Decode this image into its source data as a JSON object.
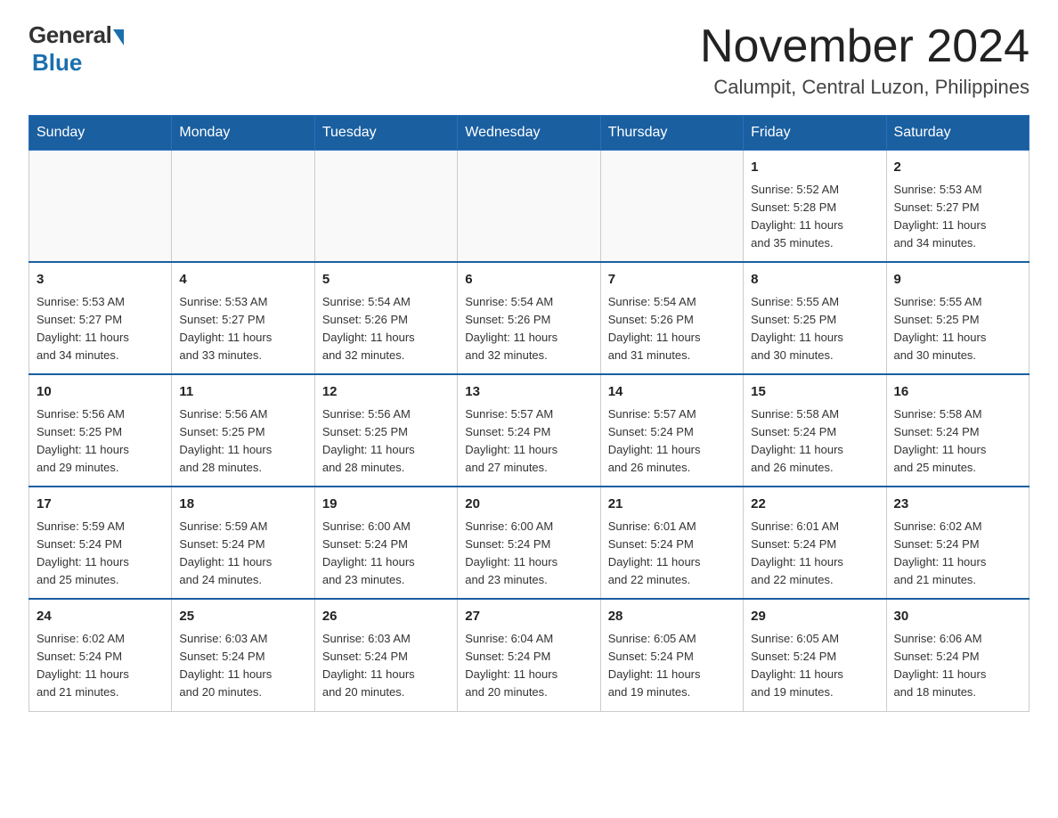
{
  "logo": {
    "general": "General",
    "blue": "Blue"
  },
  "title": "November 2024",
  "subtitle": "Calumpit, Central Luzon, Philippines",
  "weekdays": [
    "Sunday",
    "Monday",
    "Tuesday",
    "Wednesday",
    "Thursday",
    "Friday",
    "Saturday"
  ],
  "weeks": [
    [
      {
        "day": "",
        "info": ""
      },
      {
        "day": "",
        "info": ""
      },
      {
        "day": "",
        "info": ""
      },
      {
        "day": "",
        "info": ""
      },
      {
        "day": "",
        "info": ""
      },
      {
        "day": "1",
        "info": "Sunrise: 5:52 AM\nSunset: 5:28 PM\nDaylight: 11 hours\nand 35 minutes."
      },
      {
        "day": "2",
        "info": "Sunrise: 5:53 AM\nSunset: 5:27 PM\nDaylight: 11 hours\nand 34 minutes."
      }
    ],
    [
      {
        "day": "3",
        "info": "Sunrise: 5:53 AM\nSunset: 5:27 PM\nDaylight: 11 hours\nand 34 minutes."
      },
      {
        "day": "4",
        "info": "Sunrise: 5:53 AM\nSunset: 5:27 PM\nDaylight: 11 hours\nand 33 minutes."
      },
      {
        "day": "5",
        "info": "Sunrise: 5:54 AM\nSunset: 5:26 PM\nDaylight: 11 hours\nand 32 minutes."
      },
      {
        "day": "6",
        "info": "Sunrise: 5:54 AM\nSunset: 5:26 PM\nDaylight: 11 hours\nand 32 minutes."
      },
      {
        "day": "7",
        "info": "Sunrise: 5:54 AM\nSunset: 5:26 PM\nDaylight: 11 hours\nand 31 minutes."
      },
      {
        "day": "8",
        "info": "Sunrise: 5:55 AM\nSunset: 5:25 PM\nDaylight: 11 hours\nand 30 minutes."
      },
      {
        "day": "9",
        "info": "Sunrise: 5:55 AM\nSunset: 5:25 PM\nDaylight: 11 hours\nand 30 minutes."
      }
    ],
    [
      {
        "day": "10",
        "info": "Sunrise: 5:56 AM\nSunset: 5:25 PM\nDaylight: 11 hours\nand 29 minutes."
      },
      {
        "day": "11",
        "info": "Sunrise: 5:56 AM\nSunset: 5:25 PM\nDaylight: 11 hours\nand 28 minutes."
      },
      {
        "day": "12",
        "info": "Sunrise: 5:56 AM\nSunset: 5:25 PM\nDaylight: 11 hours\nand 28 minutes."
      },
      {
        "day": "13",
        "info": "Sunrise: 5:57 AM\nSunset: 5:24 PM\nDaylight: 11 hours\nand 27 minutes."
      },
      {
        "day": "14",
        "info": "Sunrise: 5:57 AM\nSunset: 5:24 PM\nDaylight: 11 hours\nand 26 minutes."
      },
      {
        "day": "15",
        "info": "Sunrise: 5:58 AM\nSunset: 5:24 PM\nDaylight: 11 hours\nand 26 minutes."
      },
      {
        "day": "16",
        "info": "Sunrise: 5:58 AM\nSunset: 5:24 PM\nDaylight: 11 hours\nand 25 minutes."
      }
    ],
    [
      {
        "day": "17",
        "info": "Sunrise: 5:59 AM\nSunset: 5:24 PM\nDaylight: 11 hours\nand 25 minutes."
      },
      {
        "day": "18",
        "info": "Sunrise: 5:59 AM\nSunset: 5:24 PM\nDaylight: 11 hours\nand 24 minutes."
      },
      {
        "day": "19",
        "info": "Sunrise: 6:00 AM\nSunset: 5:24 PM\nDaylight: 11 hours\nand 23 minutes."
      },
      {
        "day": "20",
        "info": "Sunrise: 6:00 AM\nSunset: 5:24 PM\nDaylight: 11 hours\nand 23 minutes."
      },
      {
        "day": "21",
        "info": "Sunrise: 6:01 AM\nSunset: 5:24 PM\nDaylight: 11 hours\nand 22 minutes."
      },
      {
        "day": "22",
        "info": "Sunrise: 6:01 AM\nSunset: 5:24 PM\nDaylight: 11 hours\nand 22 minutes."
      },
      {
        "day": "23",
        "info": "Sunrise: 6:02 AM\nSunset: 5:24 PM\nDaylight: 11 hours\nand 21 minutes."
      }
    ],
    [
      {
        "day": "24",
        "info": "Sunrise: 6:02 AM\nSunset: 5:24 PM\nDaylight: 11 hours\nand 21 minutes."
      },
      {
        "day": "25",
        "info": "Sunrise: 6:03 AM\nSunset: 5:24 PM\nDaylight: 11 hours\nand 20 minutes."
      },
      {
        "day": "26",
        "info": "Sunrise: 6:03 AM\nSunset: 5:24 PM\nDaylight: 11 hours\nand 20 minutes."
      },
      {
        "day": "27",
        "info": "Sunrise: 6:04 AM\nSunset: 5:24 PM\nDaylight: 11 hours\nand 20 minutes."
      },
      {
        "day": "28",
        "info": "Sunrise: 6:05 AM\nSunset: 5:24 PM\nDaylight: 11 hours\nand 19 minutes."
      },
      {
        "day": "29",
        "info": "Sunrise: 6:05 AM\nSunset: 5:24 PM\nDaylight: 11 hours\nand 19 minutes."
      },
      {
        "day": "30",
        "info": "Sunrise: 6:06 AM\nSunset: 5:24 PM\nDaylight: 11 hours\nand 18 minutes."
      }
    ]
  ]
}
